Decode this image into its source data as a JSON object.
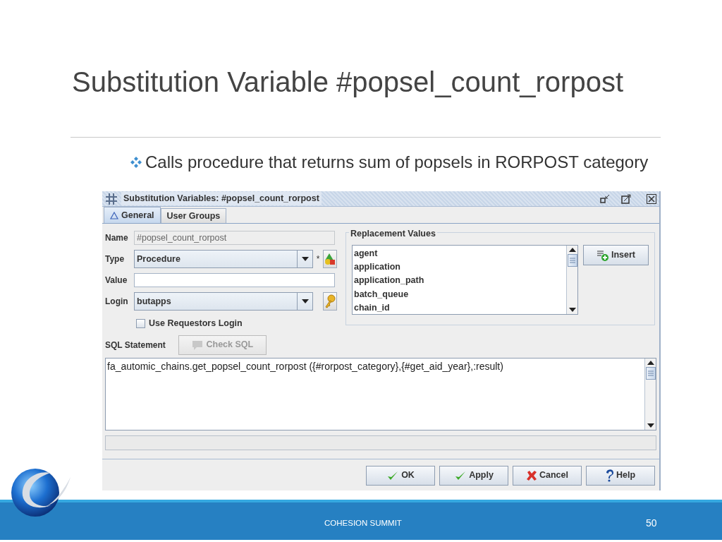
{
  "slide": {
    "title": "Substitution Variable #popsel_count_rorpost",
    "bullet": "Calls procedure that returns sum of popsels in RORPOST category",
    "footer": "COHESION SUMMIT",
    "page_number": "50"
  },
  "window": {
    "title": "Substitution Variables: #popsel_count_rorpost",
    "tabs": [
      {
        "label": "General",
        "selected": true
      },
      {
        "label": "User Groups",
        "selected": false
      }
    ],
    "fields": [
      {
        "kind": "text",
        "label": "Name",
        "value": "#popsel_count_rorpost",
        "disabled": true
      },
      {
        "kind": "combo",
        "label": "Type",
        "value": "Procedure",
        "required_mark": "*",
        "tool": {
          "kind": "shapes"
        }
      },
      {
        "kind": "text",
        "label": "Value",
        "disabled": false
      },
      {
        "kind": "combo",
        "label": "Login",
        "value": "butapps",
        "tool": {
          "kind": "key"
        }
      }
    ],
    "checkbox": {
      "label": "Use Requestors Login",
      "checked": false
    },
    "sql_label": "SQL Statement",
    "check_sql_button": {
      "label": "Check SQL",
      "disabled": true
    },
    "sql_text": "fa_automic_chains.get_popsel_count_rorpost ({#rorpost_category},{#get_aid_year},:result)",
    "replacement": {
      "title": "Replacement Values",
      "items": [
        "agent",
        "application",
        "application_path",
        "batch_queue",
        "chain_id"
      ],
      "insert_button": "Insert"
    },
    "buttons": [
      {
        "label": "OK",
        "kind": "check"
      },
      {
        "label": "Apply",
        "kind": "check"
      },
      {
        "label": "Cancel",
        "kind": "cross"
      },
      {
        "label": "Help",
        "kind": "help"
      }
    ]
  }
}
